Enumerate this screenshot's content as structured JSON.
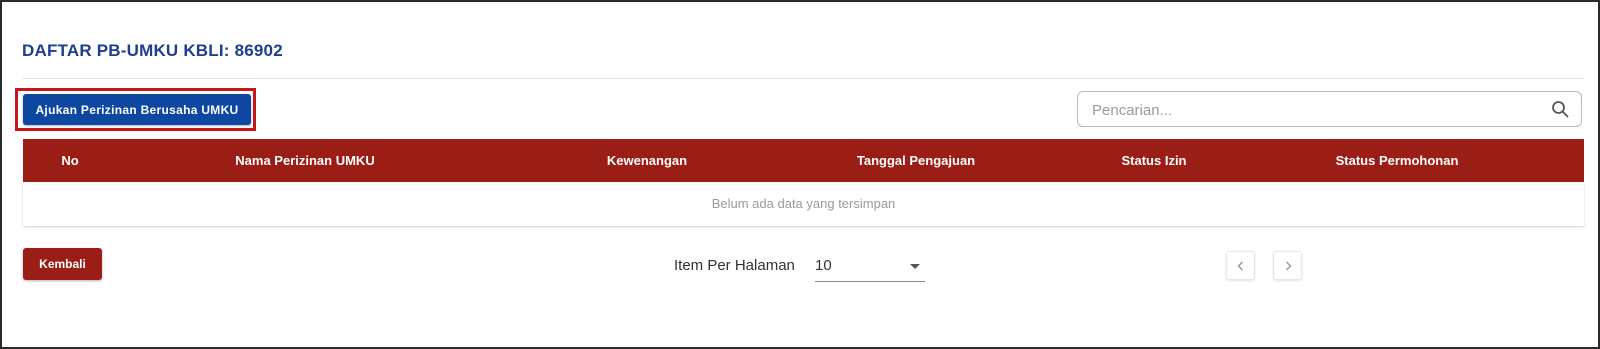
{
  "page": {
    "title": "DAFTAR PB-UMKU KBLI: 86902"
  },
  "toolbar": {
    "submit_label": "Ajukan Perizinan Berusaha UMKU",
    "search_placeholder": "Pencarian..."
  },
  "table": {
    "columns": [
      "No",
      "Nama Perizinan UMKU",
      "Kewenangan",
      "Tanggal Pengajuan",
      "Status Izin",
      "Status Permohonan"
    ],
    "empty_message": "Belum ada data yang tersimpan"
  },
  "footer": {
    "back_label": "Kembali",
    "per_page_label": "Item Per Halaman",
    "per_page_value": "10"
  },
  "icons": {
    "search": "search-icon",
    "dropdown": "caret-down-icon",
    "prev": "chevron-left-icon",
    "next": "chevron-right-icon"
  },
  "colors": {
    "primary_blue": "#0d47a1",
    "title_blue": "#1d3f8f",
    "table_header_red": "#9b1e16",
    "highlight_red": "#c4161c"
  }
}
